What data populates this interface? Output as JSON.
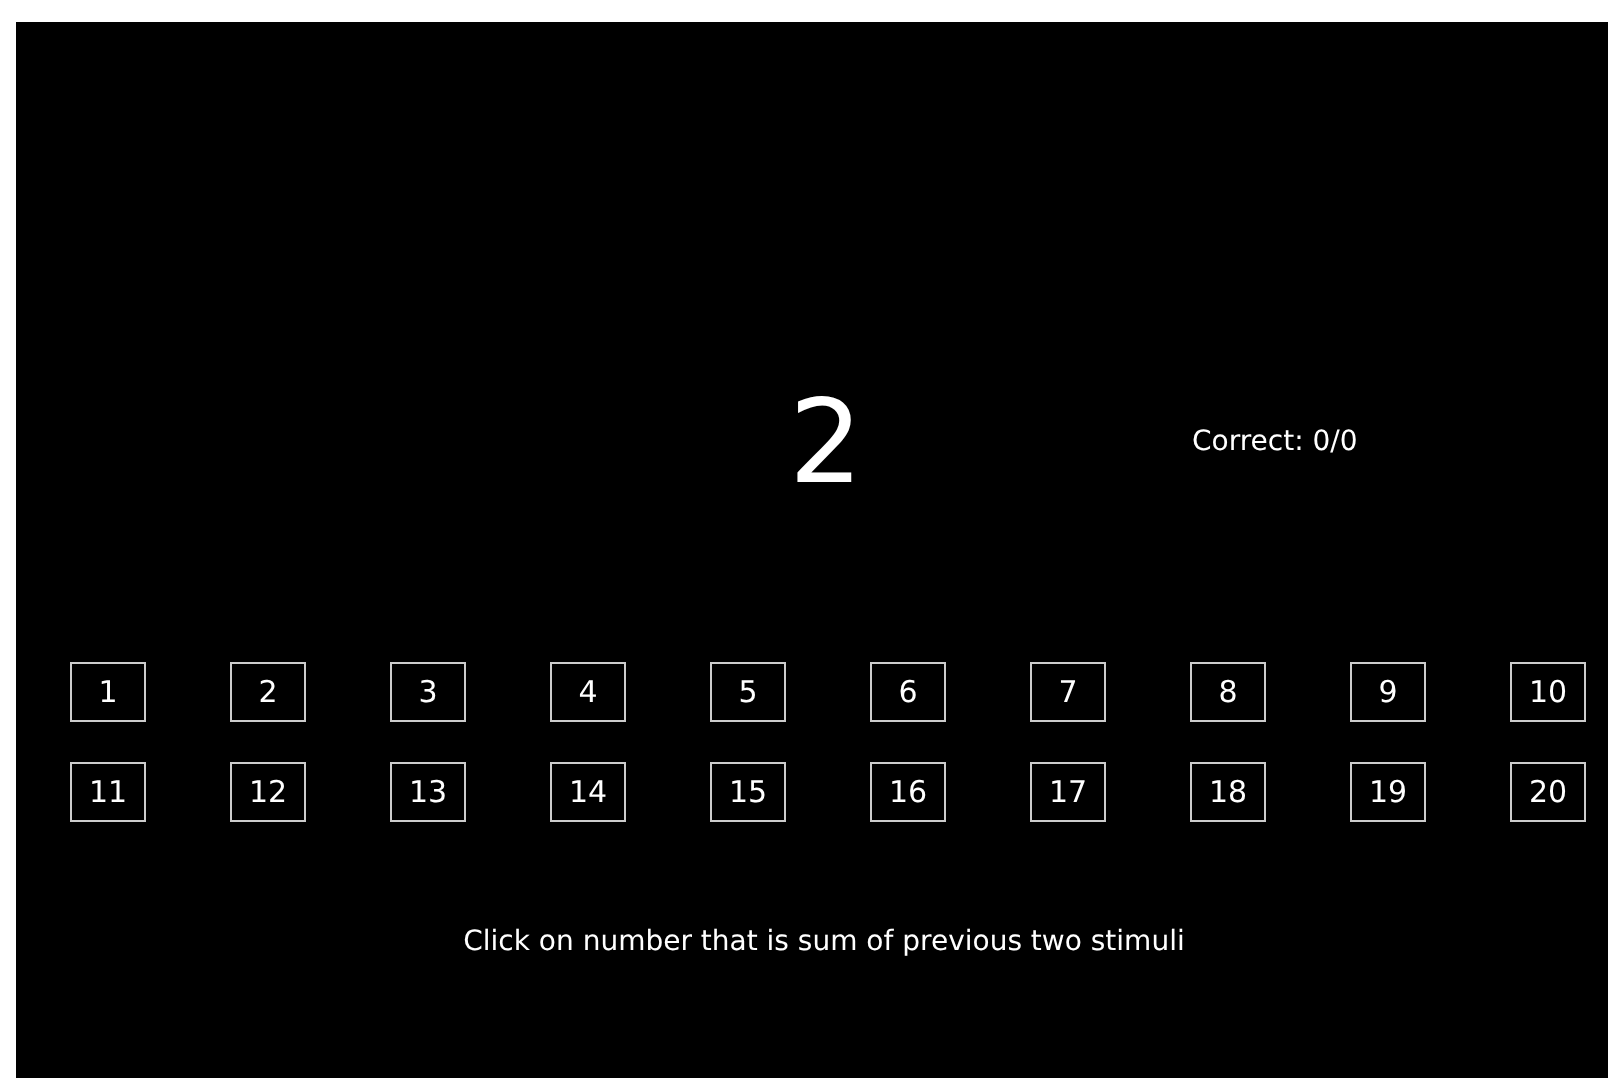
{
  "stimulus": "2",
  "score": "Correct: 0/0",
  "choices": [
    "1",
    "2",
    "3",
    "4",
    "5",
    "6",
    "7",
    "8",
    "9",
    "10",
    "11",
    "12",
    "13",
    "14",
    "15",
    "16",
    "17",
    "18",
    "19",
    "20"
  ],
  "instruction": "Click on number that is sum of previous two stimuli"
}
